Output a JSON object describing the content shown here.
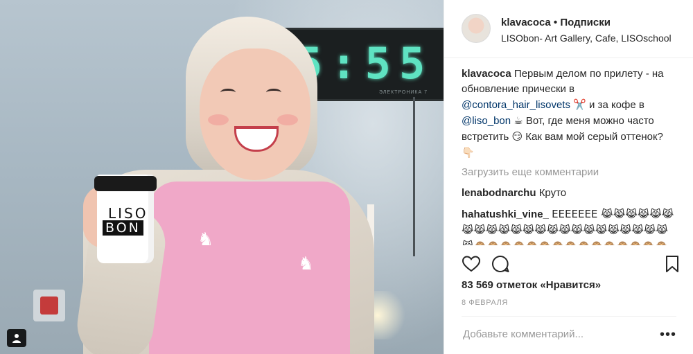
{
  "photo": {
    "clock_digits": "5:55",
    "clock_label": "ЭЛЕКТРОНИКА 7",
    "cup_line1": "LISO",
    "cup_line2": "BON"
  },
  "header": {
    "username": "klavacoca",
    "separator": "•",
    "follow_label": "Подписки",
    "location": "LISObon- Art Gallery, Cafe, LISOschool"
  },
  "caption": {
    "username": "klavacoca",
    "text_1": "Первым делом по прилету - на обновление прически в",
    "mention_1": "@contora_hair_lisovets",
    "emoji_1": "✂️",
    "text_2": "и за кофе в",
    "mention_2": "@liso_bon",
    "emoji_2": "☕",
    "text_3": "Вот, где меня можно часто встретить",
    "emoji_3": "😏",
    "text_4": "Как вам мой серый оттенок?",
    "emoji_4": "👇🏻"
  },
  "load_more_label": "Загрузить еще комментарии",
  "comments": [
    {
      "username": "lenabodnarchu",
      "text": "Круто"
    },
    {
      "username": "hahatushki_vine_",
      "text": "EEEEEEE 😹😹😹😹😹😹😹😹😹😹😹😹😹😹😹😹😹😹😹😹😹😹😹😹🙈🙈🙈🙈🙈🙈🙈🙈🙈🙈🙈🙈🙈🙈🙈🙈🙈🙈🙈🙈🙈🙈🙈🙈🙈🙈🙈🙈"
    }
  ],
  "icons": {
    "like": "heart-icon",
    "comment": "comment-bubble-icon",
    "save": "bookmark-icon",
    "user_tag": "user-tag-icon",
    "more": "more-options-icon"
  },
  "likes_text": "83 569 отметок «Нравится»",
  "date_text": "8 ФЕВРАЛЯ",
  "add_comment": {
    "placeholder": "Добавьте комментарий...",
    "more_label": "•••"
  },
  "colors": {
    "mention": "#003569",
    "muted": "#999999",
    "text": "#262626",
    "border": "#efefef"
  }
}
